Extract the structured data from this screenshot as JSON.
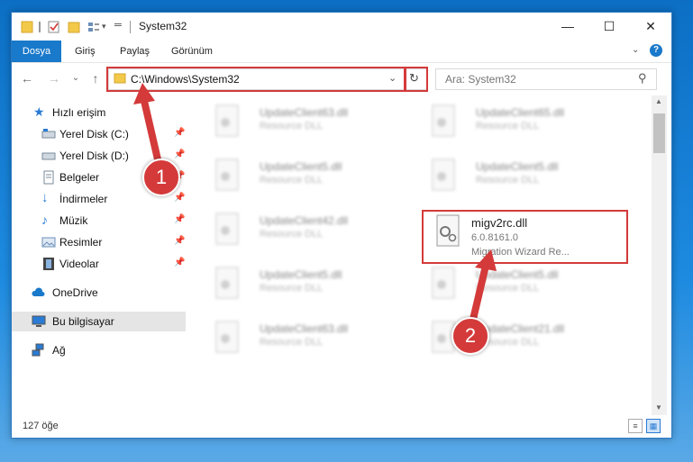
{
  "window": {
    "title": "System32",
    "status_count": "127 öğe"
  },
  "ribbon": {
    "tabs": [
      "Dosya",
      "Giriş",
      "Paylaş",
      "Görünüm"
    ]
  },
  "navbar": {
    "address": "C:\\Windows\\System32",
    "search_placeholder": "Ara: System32"
  },
  "sidebar": {
    "items": [
      {
        "label": "Hızlı erişim",
        "icon": "star-icon"
      },
      {
        "label": "Yerel Disk (C:)",
        "icon": "drive-icon"
      },
      {
        "label": "Yerel Disk (D:)",
        "icon": "drive-icon"
      },
      {
        "label": "Belgeler",
        "icon": "document-icon"
      },
      {
        "label": "İndirmeler",
        "icon": "download-icon"
      },
      {
        "label": "Müzik",
        "icon": "music-icon"
      },
      {
        "label": "Resimler",
        "icon": "pictures-icon"
      },
      {
        "label": "Videolar",
        "icon": "video-icon"
      },
      {
        "label": "OneDrive",
        "icon": "cloud-icon"
      },
      {
        "label": "Bu bilgisayar",
        "icon": "computer-icon"
      },
      {
        "label": "Ağ",
        "icon": "network-icon"
      }
    ]
  },
  "files": {
    "col1": [
      {
        "name": "UpdateClient63.dll",
        "desc": "Resource DLL"
      },
      {
        "name": "UpdateClient5.dll",
        "desc": "Resource DLL"
      },
      {
        "name": "UpdateClient42.dll",
        "desc": "Resource DLL"
      },
      {
        "name": "UpdateClient5.dll",
        "desc": "Resource DLL"
      },
      {
        "name": "UpdateClient63.dll",
        "desc": "Resource DLL"
      }
    ],
    "col2": [
      {
        "name": "UpdateClient65.dll",
        "desc": "Resource DLL"
      },
      {
        "name": "UpdateClient5.dll",
        "desc": "Resource DLL"
      },
      {
        "name": "UpdateClient5.dll",
        "desc": "Resource DLL"
      },
      {
        "name": "UpdateClient21.dll",
        "desc": "Resource DLL"
      }
    ],
    "selected": {
      "name": "migv2rc.dll",
      "version": "6.0.8161.0",
      "desc": "Migration Wizard Re..."
    }
  },
  "callouts": {
    "one": "1",
    "two": "2"
  },
  "colors": {
    "accent": "#1979ca",
    "highlight": "#d43a3a"
  }
}
